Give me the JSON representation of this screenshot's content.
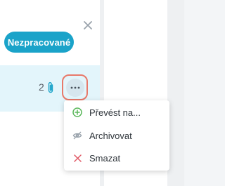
{
  "panel": {
    "status_badge": "Nezpracované",
    "attachment_count": "2"
  },
  "icons": {
    "close": "close-icon",
    "attachment": "paperclip-icon",
    "more": "more-horizontal-icon"
  },
  "menu": {
    "items": [
      {
        "label": "Převést na...",
        "icon": "plus-circle-icon",
        "color": "#5cb85c"
      },
      {
        "label": "Archivovat",
        "icon": "eye-off-icon",
        "color": "#9aa3ac"
      },
      {
        "label": "Smazat",
        "icon": "close-icon",
        "color": "#e05a67"
      }
    ]
  },
  "colors": {
    "badge": "#1aa3c9",
    "card": "#e3f5fb",
    "highlight": "#e8796a"
  }
}
